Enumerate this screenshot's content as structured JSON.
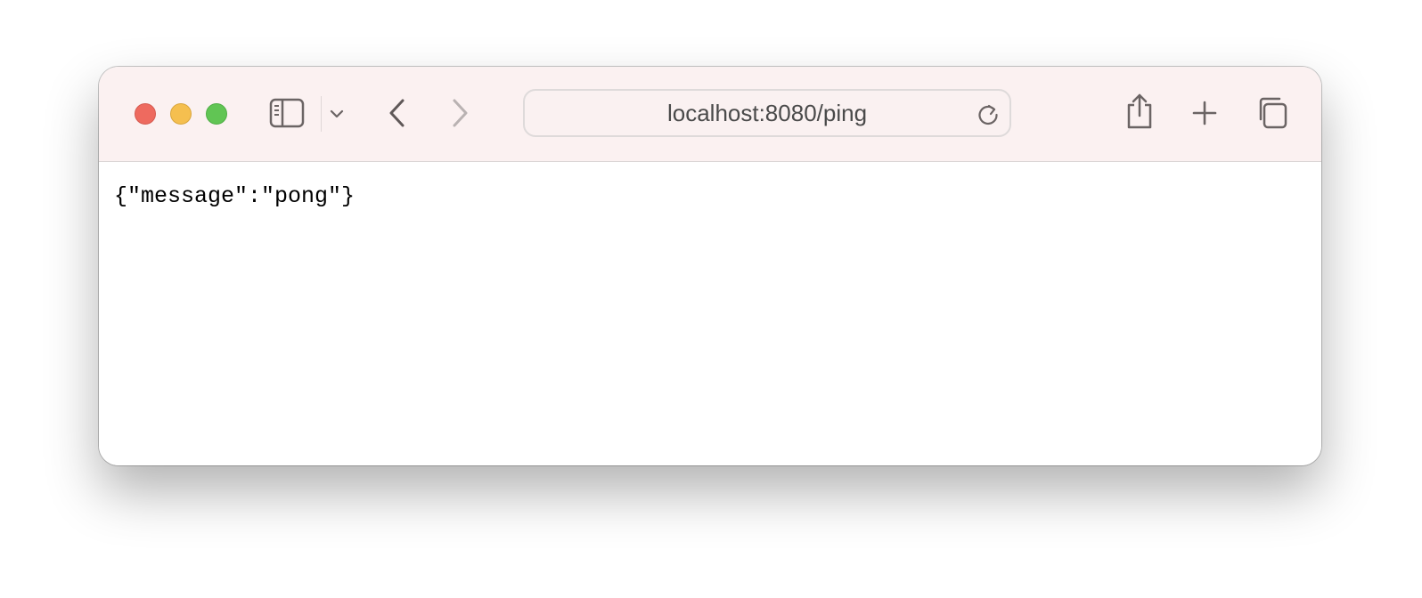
{
  "window": {
    "controls": {
      "close_color": "#ee6a5f",
      "minimize_color": "#f5bf4f",
      "maximize_color": "#61c554"
    }
  },
  "toolbar": {
    "icons": {
      "sidebar": "sidebar-icon",
      "tab_group_menu": "chevron-down-icon",
      "back": "chevron-left-icon",
      "forward": "chevron-right-icon",
      "reload": "reload-icon",
      "share": "share-icon",
      "new_tab": "plus-icon",
      "tab_overview": "tab-overview-icon"
    },
    "address_bar": {
      "url": "localhost:8080/ping"
    }
  },
  "page": {
    "body_text": "{\"message\":\"pong\"}"
  }
}
